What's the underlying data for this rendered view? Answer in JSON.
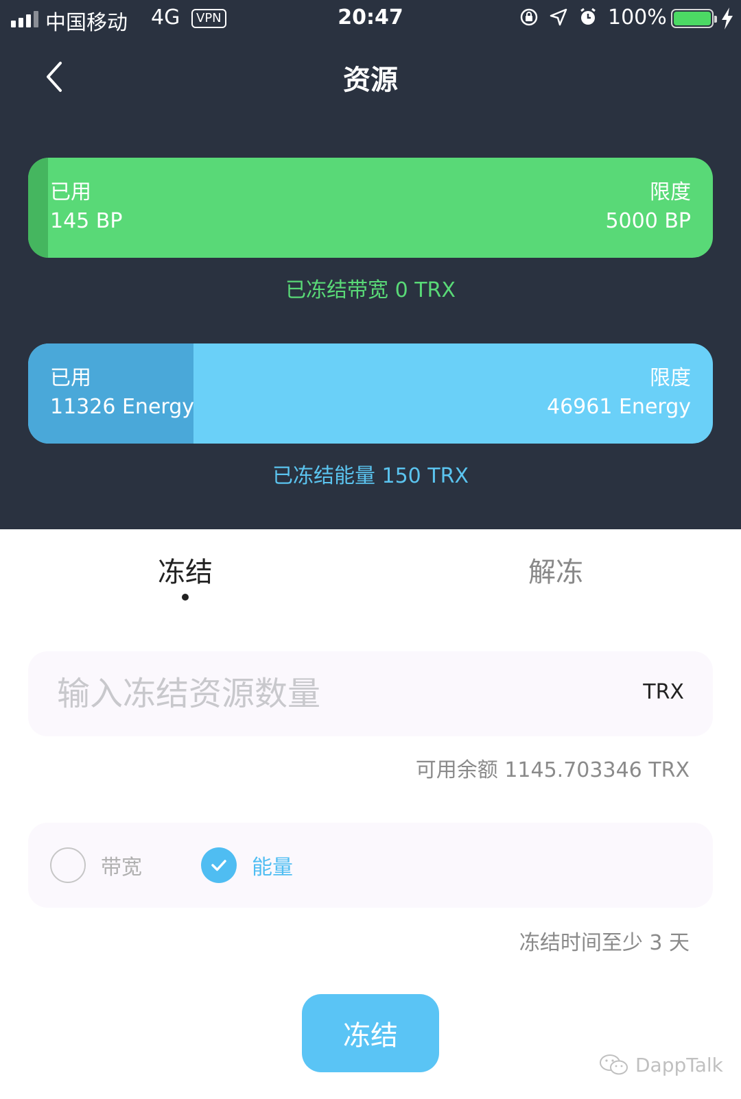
{
  "status_bar": {
    "carrier": "中国移动",
    "network": "4G",
    "vpn": "VPN",
    "time": "20:47",
    "battery": "100%",
    "icons": [
      "signal-icon",
      "orientation-lock-icon",
      "location-icon",
      "alarm-icon",
      "battery-icon",
      "charging-icon"
    ]
  },
  "nav": {
    "title": "资源"
  },
  "bandwidth": {
    "used_label": "已用",
    "used_value": "145 BP",
    "limit_label": "限度",
    "limit_value": "5000 BP",
    "used": 145,
    "limit": 5000,
    "frozen_text": "已冻结带宽 0 TRX",
    "color": "#59d977"
  },
  "energy": {
    "used_label": "已用",
    "used_value": "11326 Energy",
    "limit_label": "限度",
    "limit_value": "46961 Energy",
    "used": 11326,
    "limit": 46961,
    "frozen_text": "已冻结能量 150 TRX",
    "color": "#6ad0f8"
  },
  "tabs": {
    "freeze": "冻结",
    "unfreeze": "解冻",
    "active": "freeze"
  },
  "form": {
    "amount_placeholder": "输入冻结资源数量",
    "amount_value": "",
    "unit": "TRX",
    "balance": "可用余额 1145.703346 TRX",
    "option_bandwidth": "带宽",
    "option_energy": "能量",
    "selected": "energy",
    "hint": "冻结时间至少 3 天",
    "submit": "冻结",
    "accent": "#5ac4f5"
  },
  "watermark": "DappTalk"
}
